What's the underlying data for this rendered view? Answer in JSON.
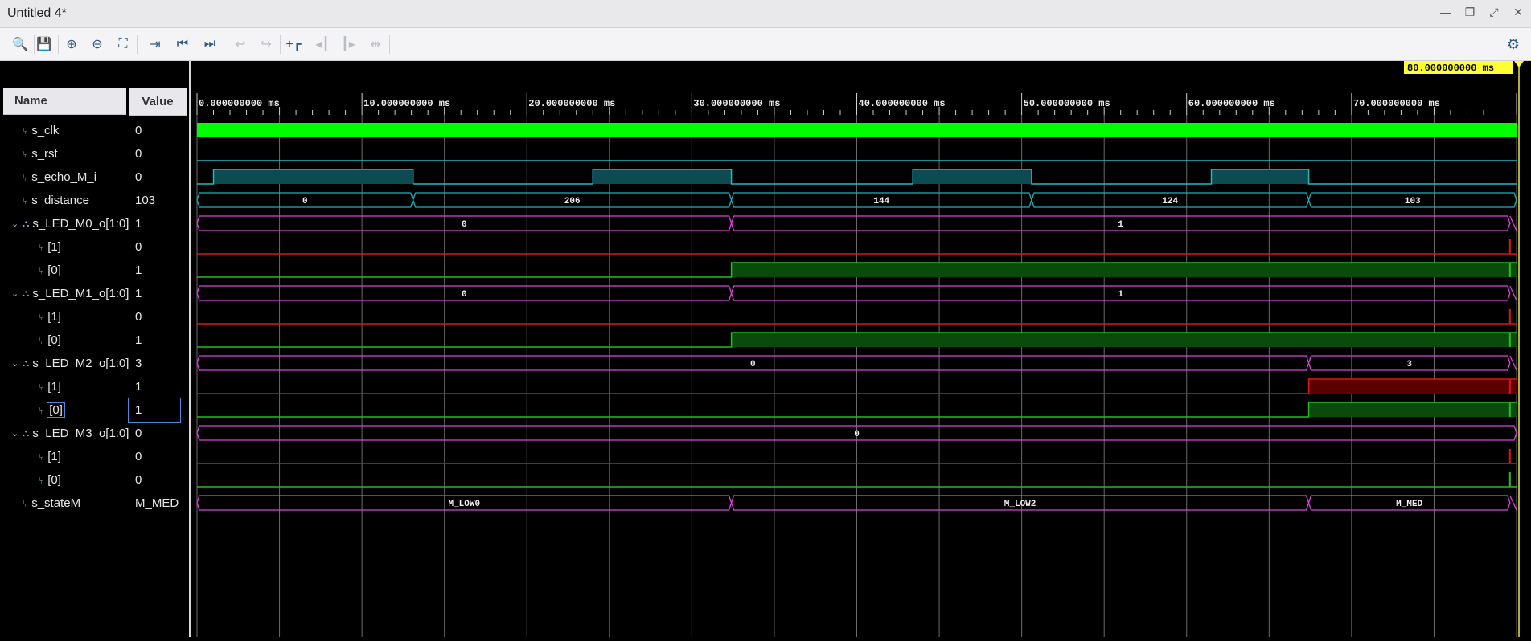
{
  "window": {
    "title": "Untitled 4*"
  },
  "window_controls": [
    {
      "name": "minimize-icon",
      "glyph": "—"
    },
    {
      "name": "restore-icon",
      "glyph": "❐"
    },
    {
      "name": "maximize-icon",
      "glyph": "⤢"
    },
    {
      "name": "close-icon",
      "glyph": "✕"
    }
  ],
  "toolbar": [
    {
      "name": "search-icon",
      "glyph": "🔍",
      "enabled": true
    },
    {
      "name": "save-icon",
      "glyph": "💾",
      "enabled": true
    },
    {
      "name": "zoom-in-icon",
      "glyph": "⊕",
      "enabled": true
    },
    {
      "name": "zoom-out-icon",
      "glyph": "⊖",
      "enabled": true
    },
    {
      "name": "zoom-fit-icon",
      "glyph": "⛶",
      "enabled": true
    },
    {
      "name": "go-to-cursor-icon",
      "glyph": "⇥",
      "enabled": true
    },
    {
      "name": "go-to-time-zero-icon",
      "glyph": "⏮",
      "enabled": true
    },
    {
      "name": "go-to-last-time-icon",
      "glyph": "⏭",
      "enabled": true
    },
    {
      "name": "previous-transition-icon",
      "glyph": "↩",
      "enabled": false
    },
    {
      "name": "next-transition-icon",
      "glyph": "↪",
      "enabled": false
    },
    {
      "name": "add-marker-icon",
      "glyph": "+┏",
      "enabled": true
    },
    {
      "name": "previous-marker-icon",
      "glyph": "◂┃",
      "enabled": false
    },
    {
      "name": "next-marker-icon",
      "glyph": "┃▸",
      "enabled": false
    },
    {
      "name": "swap-cursors-icon",
      "glyph": "⇹",
      "enabled": false
    }
  ],
  "settings_icon": "⚙",
  "columns": {
    "name": "Name",
    "value": "Value"
  },
  "cursor_time": "80.000000000 ms",
  "time_axis": {
    "unit": "ms",
    "start": 0,
    "end": 80,
    "labels": [
      "0.000000000 ms",
      "10.000000000 ms",
      "20.000000000 ms",
      "30.000000000 ms",
      "40.000000000 ms",
      "50.000000000 ms",
      "60.000000000 ms",
      "70.000000000 ms"
    ]
  },
  "signals": [
    {
      "name": "s_clk",
      "value": "0",
      "kind": "clock",
      "indent": 0
    },
    {
      "name": "s_rst",
      "value": "0",
      "kind": "bit",
      "indent": 0,
      "transitions": [
        [
          0,
          0
        ]
      ]
    },
    {
      "name": "s_echo_M_i",
      "value": "0",
      "kind": "bit",
      "indent": 0,
      "transitions": [
        [
          0,
          0
        ],
        [
          1,
          1
        ],
        [
          13.1,
          0
        ],
        [
          24,
          1
        ],
        [
          32.4,
          0
        ],
        [
          43.4,
          1
        ],
        [
          50.6,
          0
        ],
        [
          61.5,
          1
        ],
        [
          67.4,
          0
        ]
      ]
    },
    {
      "name": "s_distance",
      "value": "103",
      "kind": "bus",
      "indent": 0,
      "segments": [
        [
          0,
          13.1,
          "0"
        ],
        [
          13.1,
          32.4,
          "206"
        ],
        [
          32.4,
          50.6,
          "144"
        ],
        [
          50.6,
          67.4,
          "124"
        ],
        [
          67.4,
          80,
          "103"
        ]
      ]
    },
    {
      "name": "s_LED_M0_o[1:0]",
      "value": "1",
      "kind": "busv",
      "indent": 0,
      "expandable": true,
      "segments": [
        [
          0,
          32.4,
          "0"
        ],
        [
          32.4,
          79.6,
          "1"
        ]
      ]
    },
    {
      "name": "[1]",
      "value": "0",
      "kind": "bit",
      "indent": 1,
      "color": "red",
      "transitions": [
        [
          0,
          0
        ]
      ]
    },
    {
      "name": "[0]",
      "value": "1",
      "kind": "bit",
      "indent": 1,
      "color": "green",
      "transitions": [
        [
          0,
          0
        ],
        [
          32.4,
          1
        ]
      ]
    },
    {
      "name": "s_LED_M1_o[1:0]",
      "value": "1",
      "kind": "busv",
      "indent": 0,
      "expandable": true,
      "segments": [
        [
          0,
          32.4,
          "0"
        ],
        [
          32.4,
          79.6,
          "1"
        ]
      ]
    },
    {
      "name": "[1]",
      "value": "0",
      "kind": "bit",
      "indent": 1,
      "color": "red",
      "transitions": [
        [
          0,
          0
        ]
      ]
    },
    {
      "name": "[0]",
      "value": "1",
      "kind": "bit",
      "indent": 1,
      "color": "green",
      "transitions": [
        [
          0,
          0
        ],
        [
          32.4,
          1
        ]
      ]
    },
    {
      "name": "s_LED_M2_o[1:0]",
      "value": "3",
      "kind": "busv",
      "indent": 0,
      "expandable": true,
      "segments": [
        [
          0,
          67.4,
          "0"
        ],
        [
          67.4,
          79.6,
          "3"
        ]
      ]
    },
    {
      "name": "[1]",
      "value": "1",
      "kind": "bit",
      "indent": 1,
      "color": "red",
      "transitions": [
        [
          0,
          0
        ],
        [
          67.4,
          1
        ]
      ]
    },
    {
      "name": "[0]",
      "value": "1",
      "kind": "bit",
      "indent": 1,
      "color": "green",
      "selected": true,
      "transitions": [
        [
          0,
          0
        ],
        [
          67.4,
          1
        ]
      ]
    },
    {
      "name": "s_LED_M3_o[1:0]",
      "value": "0",
      "kind": "busv",
      "indent": 0,
      "expandable": true,
      "segments": [
        [
          0,
          80,
          "0"
        ]
      ]
    },
    {
      "name": "[1]",
      "value": "0",
      "kind": "bit",
      "indent": 1,
      "color": "red",
      "transitions": [
        [
          0,
          0
        ]
      ]
    },
    {
      "name": "[0]",
      "value": "0",
      "kind": "bit",
      "indent": 1,
      "color": "green",
      "transitions": [
        [
          0,
          0
        ]
      ]
    },
    {
      "name": "s_stateM",
      "value": "M_MED",
      "kind": "busv",
      "indent": 0,
      "segments": [
        [
          0,
          32.4,
          "M_LOW0"
        ],
        [
          32.4,
          67.4,
          "M_LOW2"
        ],
        [
          67.4,
          79.6,
          "M_MED"
        ]
      ]
    }
  ],
  "colors": {
    "clock": "#00ff00",
    "bit_teal": "#22b7c6",
    "bus_teal": "#1fb0bd",
    "bus_magenta": "#e040e0",
    "bit_red": "#e01515",
    "bit_green": "#20c020",
    "grid": "#6a6a6a",
    "cursor": "#e8e84a"
  }
}
